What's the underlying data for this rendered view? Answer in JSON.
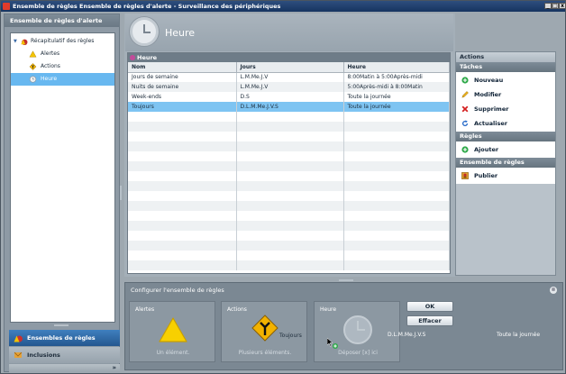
{
  "window": {
    "title": "Ensemble de règles Ensemble de règles d'alerte - Surveillance des périphériques",
    "controls": [
      "_",
      "□",
      "x"
    ]
  },
  "left": {
    "header": "Ensemble de règles d'alerte",
    "tree": [
      {
        "label": "Récapitulatif des règles",
        "icon": "summary-icon"
      },
      {
        "label": "Alertes",
        "icon": "warning-icon"
      },
      {
        "label": "Actions",
        "icon": "action-sign-icon"
      },
      {
        "label": "Heure",
        "icon": "clock-icon"
      }
    ],
    "nav": [
      {
        "label": "Ensembles de règles",
        "icon": "ruleset-icon"
      },
      {
        "label": "Inclusions",
        "icon": "inclusions-icon"
      }
    ],
    "more": "»"
  },
  "main": {
    "title": "Heure",
    "grid": {
      "title": "Heure",
      "columns": [
        "Nom",
        "Jours",
        "Heure"
      ],
      "rows": [
        [
          "Jours de semaine",
          "L.M.Me.J.V",
          "8:00Matin à 5:00Après-midi"
        ],
        [
          "Nuits de semaine",
          "L.M.Me.J.V",
          "5:00Après-midi à 8:00Matin"
        ],
        [
          "Week-ends",
          "D.S",
          "Toute la journée"
        ],
        [
          "Toujours",
          "D.L.M.Me.J.V.S",
          "Toute la journée"
        ]
      ],
      "selected_row": 3
    }
  },
  "actions": {
    "title": "Actions",
    "sections": [
      {
        "title": "Tâches",
        "items": [
          {
            "label": "Nouveau",
            "icon": "add-icon"
          },
          {
            "label": "Modifier",
            "icon": "edit-pencil-icon"
          },
          {
            "label": "Supprimer",
            "icon": "delete-icon"
          },
          {
            "label": "Actualiser",
            "icon": "refresh-icon"
          }
        ]
      },
      {
        "title": "Règles",
        "items": [
          {
            "label": "Ajouter",
            "icon": "add-icon"
          }
        ]
      },
      {
        "title": "Ensemble de règles",
        "items": [
          {
            "label": "Publier",
            "icon": "publish-icon"
          }
        ]
      }
    ]
  },
  "config": {
    "title": "Configurer l'ensemble de règles",
    "slots": [
      {
        "label": "Alertes",
        "sub": "Un élément.",
        "value": ""
      },
      {
        "label": "Actions",
        "sub": "Plusieurs éléments.",
        "value": "Toujours"
      },
      {
        "label": "Heure",
        "sub": "Déposer [x] ici",
        "value": ""
      }
    ],
    "ok": "OK",
    "clear": "Effacer",
    "days": "D.L.M.Me.J.V.S",
    "time": "Toute la journée"
  },
  "colors": {
    "selected": "#7ec4f2",
    "titlebar": "#1f3f6d"
  }
}
